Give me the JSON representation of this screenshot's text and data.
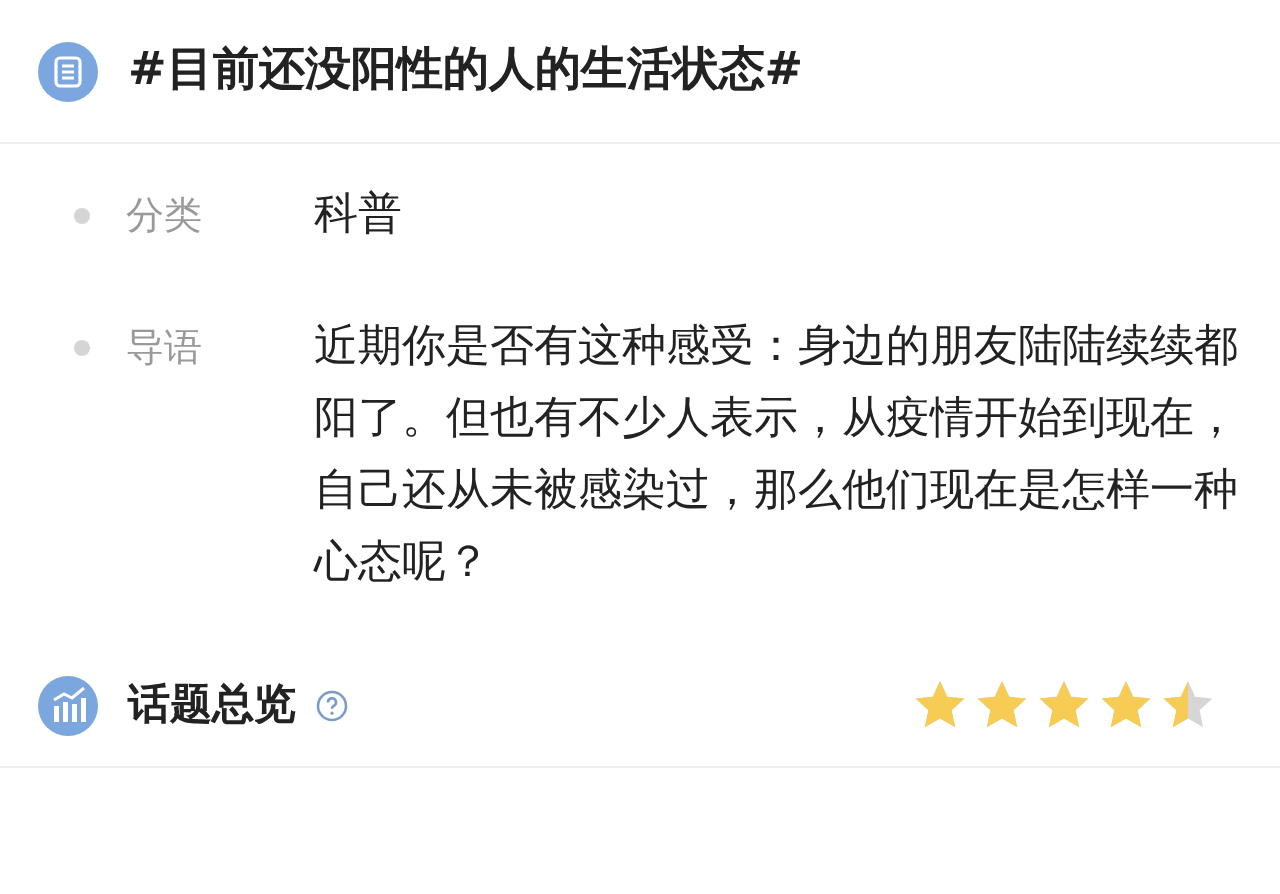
{
  "title": "#目前还没阳性的人的生活状态#",
  "fields": [
    {
      "label": "分类",
      "value": "科普"
    },
    {
      "label": "导语",
      "value": "近期你是否有这种感受：身边的朋友陆陆续续都阳了。但也有不少人表示，从疫情开始到现在，自己还从未被感染过，那么他们现在是怎样一种心态呢？"
    }
  ],
  "overview": {
    "title": "话题总览",
    "stars": 4.5
  }
}
